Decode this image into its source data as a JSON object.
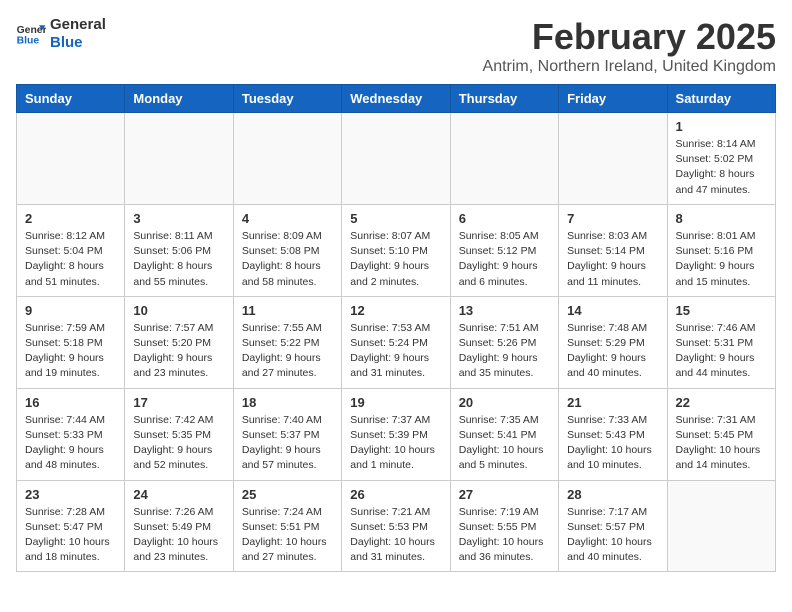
{
  "header": {
    "logo_line1": "General",
    "logo_line2": "Blue",
    "month": "February 2025",
    "location": "Antrim, Northern Ireland, United Kingdom"
  },
  "days_of_week": [
    "Sunday",
    "Monday",
    "Tuesday",
    "Wednesday",
    "Thursday",
    "Friday",
    "Saturday"
  ],
  "weeks": [
    [
      {
        "day": "",
        "detail": ""
      },
      {
        "day": "",
        "detail": ""
      },
      {
        "day": "",
        "detail": ""
      },
      {
        "day": "",
        "detail": ""
      },
      {
        "day": "",
        "detail": ""
      },
      {
        "day": "",
        "detail": ""
      },
      {
        "day": "1",
        "detail": "Sunrise: 8:14 AM\nSunset: 5:02 PM\nDaylight: 8 hours and 47 minutes."
      }
    ],
    [
      {
        "day": "2",
        "detail": "Sunrise: 8:12 AM\nSunset: 5:04 PM\nDaylight: 8 hours and 51 minutes."
      },
      {
        "day": "3",
        "detail": "Sunrise: 8:11 AM\nSunset: 5:06 PM\nDaylight: 8 hours and 55 minutes."
      },
      {
        "day": "4",
        "detail": "Sunrise: 8:09 AM\nSunset: 5:08 PM\nDaylight: 8 hours and 58 minutes."
      },
      {
        "day": "5",
        "detail": "Sunrise: 8:07 AM\nSunset: 5:10 PM\nDaylight: 9 hours and 2 minutes."
      },
      {
        "day": "6",
        "detail": "Sunrise: 8:05 AM\nSunset: 5:12 PM\nDaylight: 9 hours and 6 minutes."
      },
      {
        "day": "7",
        "detail": "Sunrise: 8:03 AM\nSunset: 5:14 PM\nDaylight: 9 hours and 11 minutes."
      },
      {
        "day": "8",
        "detail": "Sunrise: 8:01 AM\nSunset: 5:16 PM\nDaylight: 9 hours and 15 minutes."
      }
    ],
    [
      {
        "day": "9",
        "detail": "Sunrise: 7:59 AM\nSunset: 5:18 PM\nDaylight: 9 hours and 19 minutes."
      },
      {
        "day": "10",
        "detail": "Sunrise: 7:57 AM\nSunset: 5:20 PM\nDaylight: 9 hours and 23 minutes."
      },
      {
        "day": "11",
        "detail": "Sunrise: 7:55 AM\nSunset: 5:22 PM\nDaylight: 9 hours and 27 minutes."
      },
      {
        "day": "12",
        "detail": "Sunrise: 7:53 AM\nSunset: 5:24 PM\nDaylight: 9 hours and 31 minutes."
      },
      {
        "day": "13",
        "detail": "Sunrise: 7:51 AM\nSunset: 5:26 PM\nDaylight: 9 hours and 35 minutes."
      },
      {
        "day": "14",
        "detail": "Sunrise: 7:48 AM\nSunset: 5:29 PM\nDaylight: 9 hours and 40 minutes."
      },
      {
        "day": "15",
        "detail": "Sunrise: 7:46 AM\nSunset: 5:31 PM\nDaylight: 9 hours and 44 minutes."
      }
    ],
    [
      {
        "day": "16",
        "detail": "Sunrise: 7:44 AM\nSunset: 5:33 PM\nDaylight: 9 hours and 48 minutes."
      },
      {
        "day": "17",
        "detail": "Sunrise: 7:42 AM\nSunset: 5:35 PM\nDaylight: 9 hours and 52 minutes."
      },
      {
        "day": "18",
        "detail": "Sunrise: 7:40 AM\nSunset: 5:37 PM\nDaylight: 9 hours and 57 minutes."
      },
      {
        "day": "19",
        "detail": "Sunrise: 7:37 AM\nSunset: 5:39 PM\nDaylight: 10 hours and 1 minute."
      },
      {
        "day": "20",
        "detail": "Sunrise: 7:35 AM\nSunset: 5:41 PM\nDaylight: 10 hours and 5 minutes."
      },
      {
        "day": "21",
        "detail": "Sunrise: 7:33 AM\nSunset: 5:43 PM\nDaylight: 10 hours and 10 minutes."
      },
      {
        "day": "22",
        "detail": "Sunrise: 7:31 AM\nSunset: 5:45 PM\nDaylight: 10 hours and 14 minutes."
      }
    ],
    [
      {
        "day": "23",
        "detail": "Sunrise: 7:28 AM\nSunset: 5:47 PM\nDaylight: 10 hours and 18 minutes."
      },
      {
        "day": "24",
        "detail": "Sunrise: 7:26 AM\nSunset: 5:49 PM\nDaylight: 10 hours and 23 minutes."
      },
      {
        "day": "25",
        "detail": "Sunrise: 7:24 AM\nSunset: 5:51 PM\nDaylight: 10 hours and 27 minutes."
      },
      {
        "day": "26",
        "detail": "Sunrise: 7:21 AM\nSunset: 5:53 PM\nDaylight: 10 hours and 31 minutes."
      },
      {
        "day": "27",
        "detail": "Sunrise: 7:19 AM\nSunset: 5:55 PM\nDaylight: 10 hours and 36 minutes."
      },
      {
        "day": "28",
        "detail": "Sunrise: 7:17 AM\nSunset: 5:57 PM\nDaylight: 10 hours and 40 minutes."
      },
      {
        "day": "",
        "detail": ""
      }
    ]
  ]
}
